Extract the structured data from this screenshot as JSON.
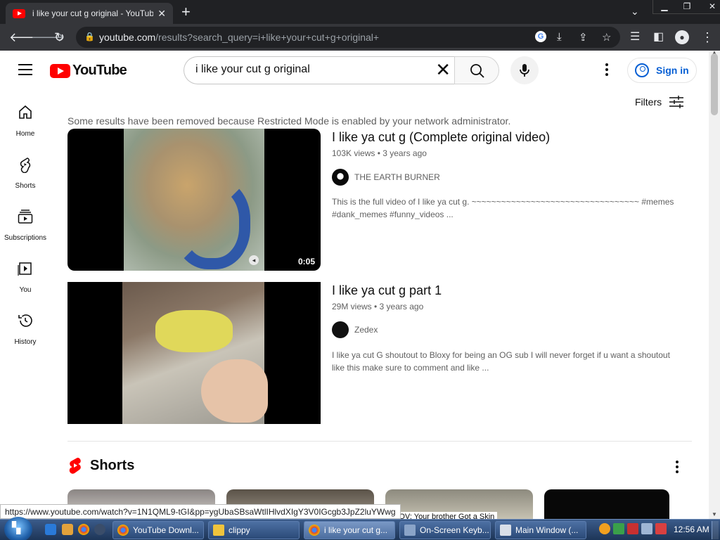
{
  "browser": {
    "tab_title": "i like your cut g original - YouTube",
    "tab_close": "✕",
    "new_tab": "+",
    "chevron": "⌄",
    "window_controls": {
      "minimize": "▁",
      "restore": "❐",
      "close": "✕"
    },
    "url_host": "youtube.com",
    "url_path": "/results?search_query=i+like+your+cut+g+original+"
  },
  "header": {
    "logo_text": "YouTube",
    "search_value": "i like your cut g original",
    "clear_glyph": "✕",
    "signin_label": "Sign in"
  },
  "leftnav": {
    "items": [
      {
        "label": "Home",
        "icon": "home-icon"
      },
      {
        "label": "Shorts",
        "icon": "shorts-icon"
      },
      {
        "label": "Subscriptions",
        "icon": "subscriptions-icon"
      },
      {
        "label": "You",
        "icon": "you-icon"
      },
      {
        "label": "History",
        "icon": "history-icon"
      }
    ]
  },
  "filters_label": "Filters",
  "restricted_notice": "Some results have been removed because Restricted Mode is enabled by your network administrator.",
  "results": [
    {
      "title": "I like ya cut g (Complete original video)",
      "meta": "103K views • 3 years ago",
      "channel": "THE EARTH BURNER",
      "description": "This is the full video of I like ya cut g. ~~~~~~~~~~~~~~~~~~~~~~~~~~~~~~~~~~ #memes #dank_memes #funny_videos ...",
      "duration": "0:05"
    },
    {
      "title": "I like ya cut g part 1",
      "meta": "29M views • 3 years ago",
      "channel": "Zedex",
      "description": "I like ya cut G shoutout to Bloxy for being an OG sub I will never forget if u want a shoutout like this make sure to comment and like ..."
    }
  ],
  "shorts": {
    "heading": "Shorts",
    "cards": [
      {
        "caption": ""
      },
      {
        "caption": ""
      },
      {
        "caption": "POV: Your brother Got a Skin"
      },
      {
        "caption": ""
      }
    ]
  },
  "status_url": "https://www.youtube.com/watch?v=1N1QML9-tGI&pp=ygUbaSBsaWtlIHlvdXIgY3V0IGcgb3JpZ2luYWwg",
  "taskbar": {
    "buttons": [
      {
        "label": "YouTube Downl..."
      },
      {
        "label": "clippy"
      },
      {
        "label": "i like your cut g..."
      },
      {
        "label": "On-Screen Keyb..."
      },
      {
        "label": "Main Window (..."
      }
    ],
    "clock": "12:56 AM"
  },
  "colors": {
    "youtube_red": "#ff0000",
    "link_blue": "#065fd4",
    "chrome_dark": "#35363a"
  }
}
